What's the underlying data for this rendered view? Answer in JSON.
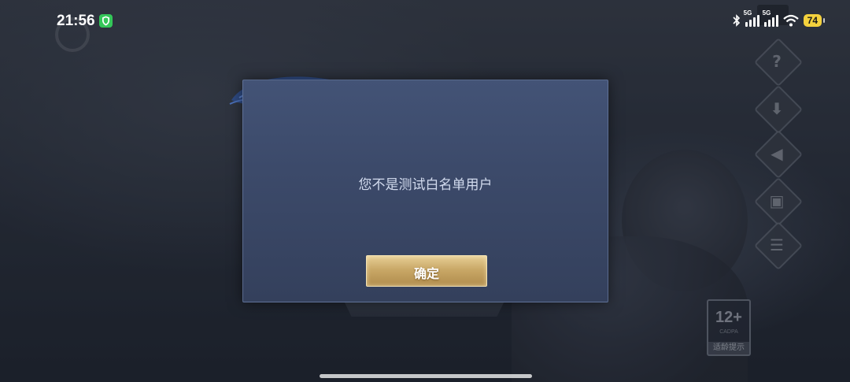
{
  "status_bar": {
    "time": "21:56",
    "signal_1_label": "5G",
    "signal_2_label": "5G",
    "battery": "74",
    "icons": [
      "shield-icon",
      "bluetooth-icon",
      "signal-icon",
      "wifi-icon",
      "battery-icon"
    ]
  },
  "dialog": {
    "message": "您不是测试白名单用户",
    "confirm_label": "确定"
  },
  "age_rating": {
    "age": "12+",
    "org": "CADPA",
    "tip": "适龄提示"
  },
  "side_icons": [
    "help-icon",
    "download-icon",
    "sound-icon",
    "account-icon",
    "notice-icon"
  ],
  "colors": {
    "dialog_bg": "#3c4a6a",
    "button_gold": "#c9a867",
    "message_text": "#d2dbee",
    "battery_yellow": "#f4d13d"
  }
}
